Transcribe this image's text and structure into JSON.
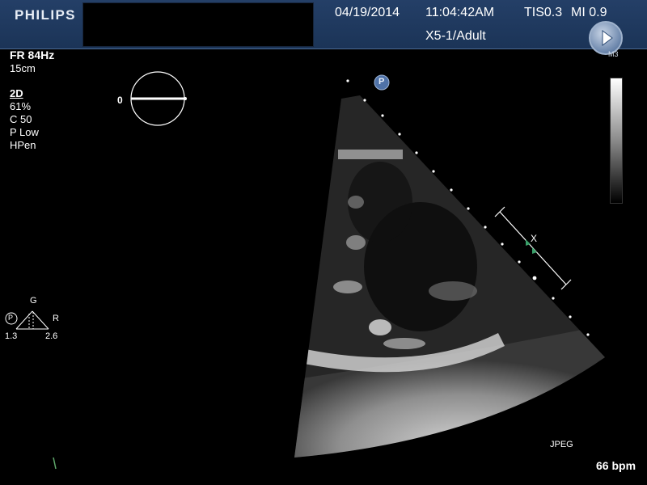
{
  "header": {
    "brand": "PHILIPS",
    "date": "04/19/2014",
    "time": "11:04:42AM",
    "tis": "TIS0.3",
    "mi": "MI 0.9",
    "probe_preset": "X5-1/Adult",
    "play_button_tag": "M3"
  },
  "params": {
    "frame_rate": "FR 84Hz",
    "depth": "15cm",
    "mode": "2D",
    "gain": " 61%",
    "compression": "C 50",
    "power": "P Low",
    "harmonic": "HPen"
  },
  "orientation": {
    "angle_label": "0"
  },
  "focus": {
    "p_label": "P",
    "g_label": "G",
    "r_label": "R",
    "left_value": "1.3",
    "right_value": "2.6"
  },
  "image": {
    "position_marker": "P",
    "caliper_label": "X",
    "format": "JPEG",
    "heart_rate": "66 bpm"
  }
}
